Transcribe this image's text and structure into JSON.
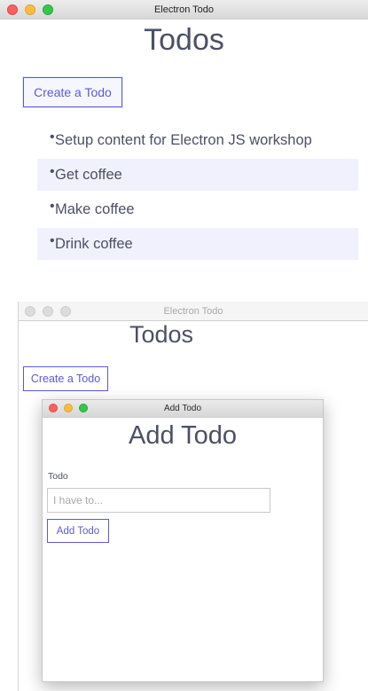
{
  "main_window": {
    "title": "Electron Todo",
    "heading": "Todos",
    "create_button_label": "Create a Todo",
    "todos": [
      "Setup content for Electron JS workshop",
      "Get coffee",
      "Make coffee",
      "Drink coffee"
    ]
  },
  "background_window": {
    "title": "Electron Todo",
    "heading": "Todos",
    "create_button_label": "Create a Todo"
  },
  "add_window": {
    "title": "Add Todo",
    "heading": "Add Todo",
    "field_label": "Todo",
    "input_placeholder": "I have to...",
    "input_value": "",
    "submit_label": "Add Todo"
  },
  "colors": {
    "accent": "#5b5bd6",
    "row_alt": "#f1f1fd",
    "text": "#4b5066"
  }
}
